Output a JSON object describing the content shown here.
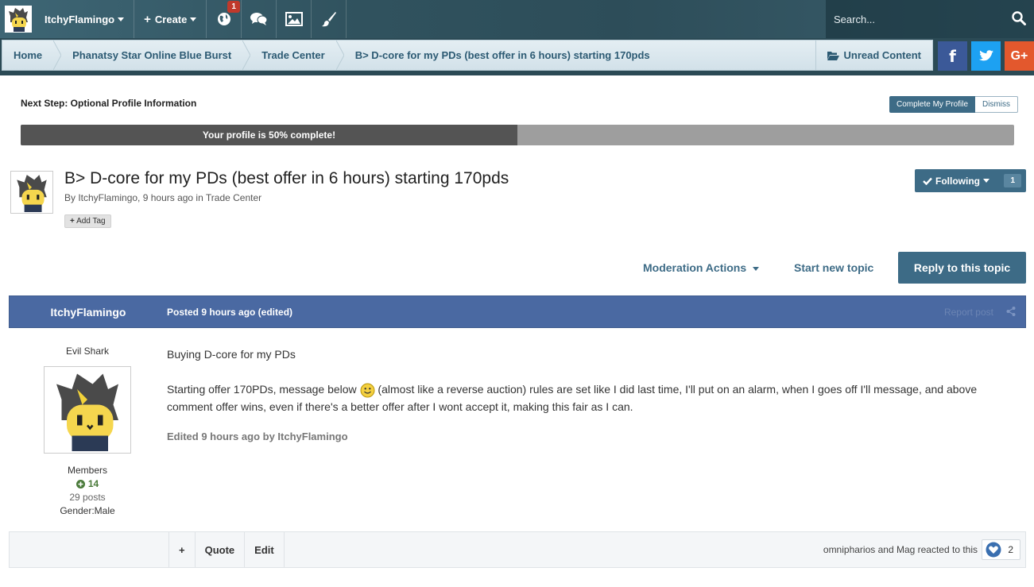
{
  "topbar": {
    "username": "ItchyFlamingo",
    "create_label": "Create",
    "notification_count": "1",
    "search_placeholder": "Search...",
    "icons": [
      "globe-icon",
      "chat-icon",
      "image-icon",
      "brush-icon",
      "search-icon"
    ]
  },
  "breadcrumb": {
    "items": [
      "Home",
      "Phanatsy Star Online Blue Burst",
      "Trade Center",
      "B> D-core for my PDs (best offer in 6 hours) starting 170pds"
    ],
    "unread_label": "Unread Content"
  },
  "social": {
    "facebook": "f",
    "google": "G+"
  },
  "profile_step": {
    "title": "Next Step: Optional Profile Information",
    "complete_label": "Complete My Profile",
    "dismiss_label": "Dismiss",
    "progress_text": "Your profile is 50% complete!",
    "progress_percent": 50
  },
  "topic": {
    "title": "B> D-core for my PDs (best offer in 6 hours) starting 170pds",
    "by_prefix": "By ",
    "author": "ItchyFlamingo",
    "time": ", 9 hours ago in ",
    "forum": "Trade Center",
    "add_tag_label": "Add Tag",
    "following_label": "Following",
    "following_count": "1",
    "mod_actions_label": "Moderation Actions",
    "start_topic_label": "Start new topic",
    "reply_label": "Reply to this topic"
  },
  "post": {
    "author": "ItchyFlamingo",
    "posted": "Posted 9 hours ago (edited)",
    "report_label": "Report post",
    "rank_title": "Evil Shark",
    "group": "Members",
    "reputation": "14",
    "post_count": "29 posts",
    "gender": "Gender:Male",
    "line1": "Buying D-core for my PDs",
    "line2a": "Starting offer 170PDs, message below ",
    "line2b": " (almost like a reverse auction) rules are set like I did last time, I'll put on an alarm, when I goes off I'll message, and above comment offer wins, even if there's a better offer after I wont accept it, making this fair as I can.",
    "edited": "Edited 9 hours ago by ItchyFlamingo",
    "footer": {
      "plus_label": "+",
      "quote_label": "Quote",
      "edit_label": "Edit",
      "reactions_text": "omnipharios and Mag reacted to this",
      "reaction_count": "2"
    }
  },
  "colors": {
    "topbar": "#30525e",
    "accent": "#3d6b86",
    "post_header": "#4a69a2"
  }
}
